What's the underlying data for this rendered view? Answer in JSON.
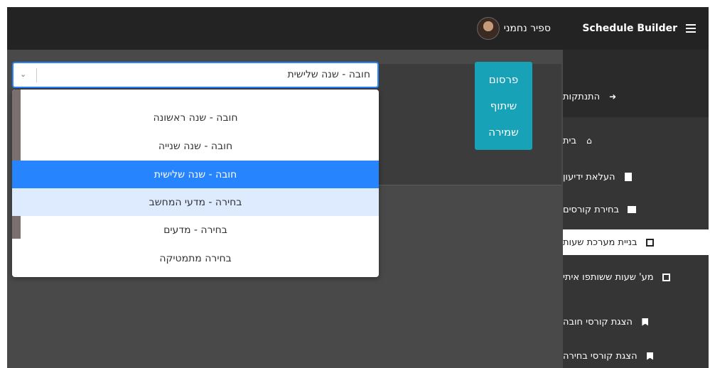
{
  "header": {
    "brand": "Schedule Builder",
    "user_name": "ספיר נחמני"
  },
  "sidebar": {
    "items": [
      {
        "label": "התנתקות",
        "icon": "sign-out-icon"
      },
      {
        "label": "בית",
        "icon": "home-icon"
      },
      {
        "label": "העלאת ידיעון",
        "icon": "file-upload-icon"
      },
      {
        "label": "בחירת קורסים",
        "icon": "archive-icon"
      },
      {
        "label": "בניית מערכת שעות",
        "icon": "calendar-icon",
        "active": true
      },
      {
        "label": "מע' שעות ששותפו איתי",
        "icon": "calendar-share-icon"
      },
      {
        "label": "הצגת קורסי חובה",
        "icon": "bookmark-icon"
      },
      {
        "label": "הצגת קורסי בחירה",
        "icon": "bookmark-icon"
      }
    ]
  },
  "actions": {
    "publish": "פרסום",
    "share": "שיתוף",
    "save": "שמירה"
  },
  "select": {
    "value": "חובה - שנה שלישית",
    "options": [
      "חובה - שנה ראשונה",
      "חובה - שנה שנייה",
      "חובה - שנה שלישית",
      "בחירה - מדעי המחשב",
      "בחירה - מדעים",
      "בחירה מתמטיקה"
    ],
    "selected_index": 2,
    "focused_index": 3
  },
  "colors": {
    "accent": "#17a2b8",
    "select_blue": "#2684ff",
    "topbar": "#232323"
  }
}
